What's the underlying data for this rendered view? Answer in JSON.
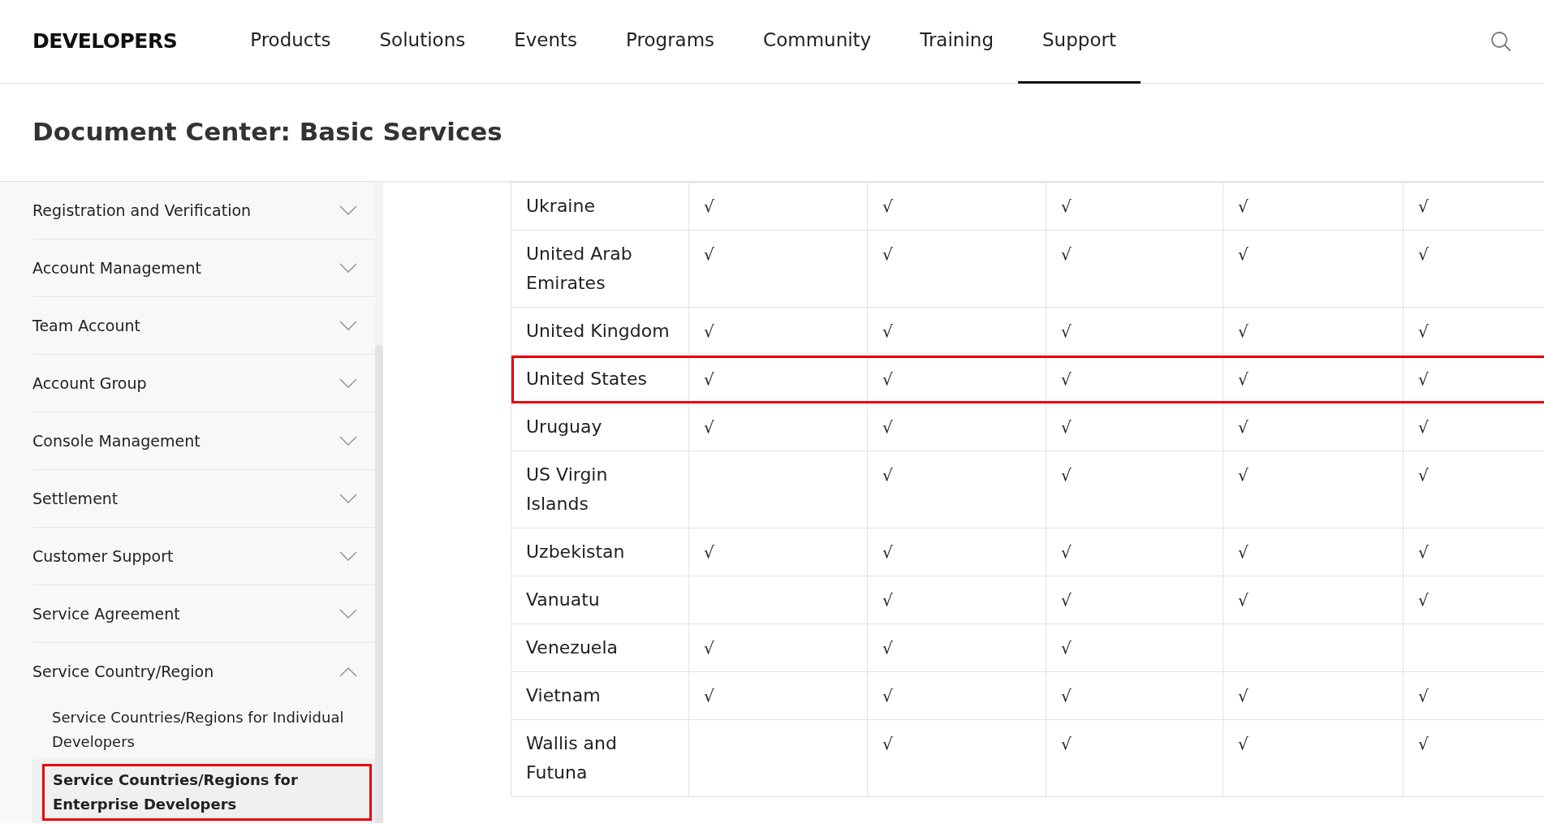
{
  "header": {
    "logo": "DEVELOPERS",
    "nav": [
      {
        "label": "Products",
        "selected": false
      },
      {
        "label": "Solutions",
        "selected": false
      },
      {
        "label": "Events",
        "selected": false
      },
      {
        "label": "Programs",
        "selected": false
      },
      {
        "label": "Community",
        "selected": false
      },
      {
        "label": "Training",
        "selected": false
      },
      {
        "label": "Support",
        "selected": true
      }
    ]
  },
  "title": "Document Center: Basic Services",
  "sidebar": {
    "items": [
      {
        "label": "Registration and Verification",
        "expanded": false
      },
      {
        "label": "Account Management",
        "expanded": false
      },
      {
        "label": "Team Account",
        "expanded": false
      },
      {
        "label": "Account Group",
        "expanded": false
      },
      {
        "label": "Console Management",
        "expanded": false
      },
      {
        "label": "Settlement",
        "expanded": false
      },
      {
        "label": "Customer Support",
        "expanded": false
      },
      {
        "label": "Service Agreement",
        "expanded": false
      },
      {
        "label": "Service Country/Region",
        "expanded": true,
        "children": [
          {
            "label": "Service Countries/Regions for Individual Developers",
            "selected": false,
            "highlighted": false
          },
          {
            "label": "Service Countries/Regions for Enterprise Developers",
            "selected": true,
            "highlighted": true
          }
        ]
      }
    ]
  },
  "table": {
    "rows": [
      {
        "country": "Ukraine",
        "highlighted": false,
        "cells": [
          "√",
          "√",
          "√",
          "√",
          "√"
        ]
      },
      {
        "country": "United Arab Emirates",
        "highlighted": false,
        "cells": [
          "√",
          "√",
          "√",
          "√",
          "√"
        ]
      },
      {
        "country": "United Kingdom",
        "highlighted": false,
        "cells": [
          "√",
          "√",
          "√",
          "√",
          "√"
        ]
      },
      {
        "country": "United States",
        "highlighted": true,
        "cells": [
          "√",
          "√",
          "√",
          "√",
          "√"
        ]
      },
      {
        "country": "Uruguay",
        "highlighted": false,
        "cells": [
          "√",
          "√",
          "√",
          "√",
          "√"
        ]
      },
      {
        "country": "US Virgin Islands",
        "highlighted": false,
        "cells": [
          null,
          "√",
          "√",
          "√",
          "√"
        ]
      },
      {
        "country": "Uzbekistan",
        "highlighted": false,
        "cells": [
          "√",
          "√",
          "√",
          "√",
          "√"
        ]
      },
      {
        "country": "Vanuatu",
        "highlighted": false,
        "cells": [
          null,
          "√",
          "√",
          "√",
          "√"
        ]
      },
      {
        "country": "Venezuela",
        "highlighted": false,
        "cells": [
          "√",
          "√",
          "√",
          null,
          null
        ]
      },
      {
        "country": "Vietnam",
        "highlighted": false,
        "cells": [
          "√",
          "√",
          "√",
          "√",
          "√"
        ]
      },
      {
        "country": "Wallis and Futuna",
        "highlighted": false,
        "cells": [
          null,
          "√",
          "√",
          "√",
          "√"
        ]
      }
    ]
  }
}
